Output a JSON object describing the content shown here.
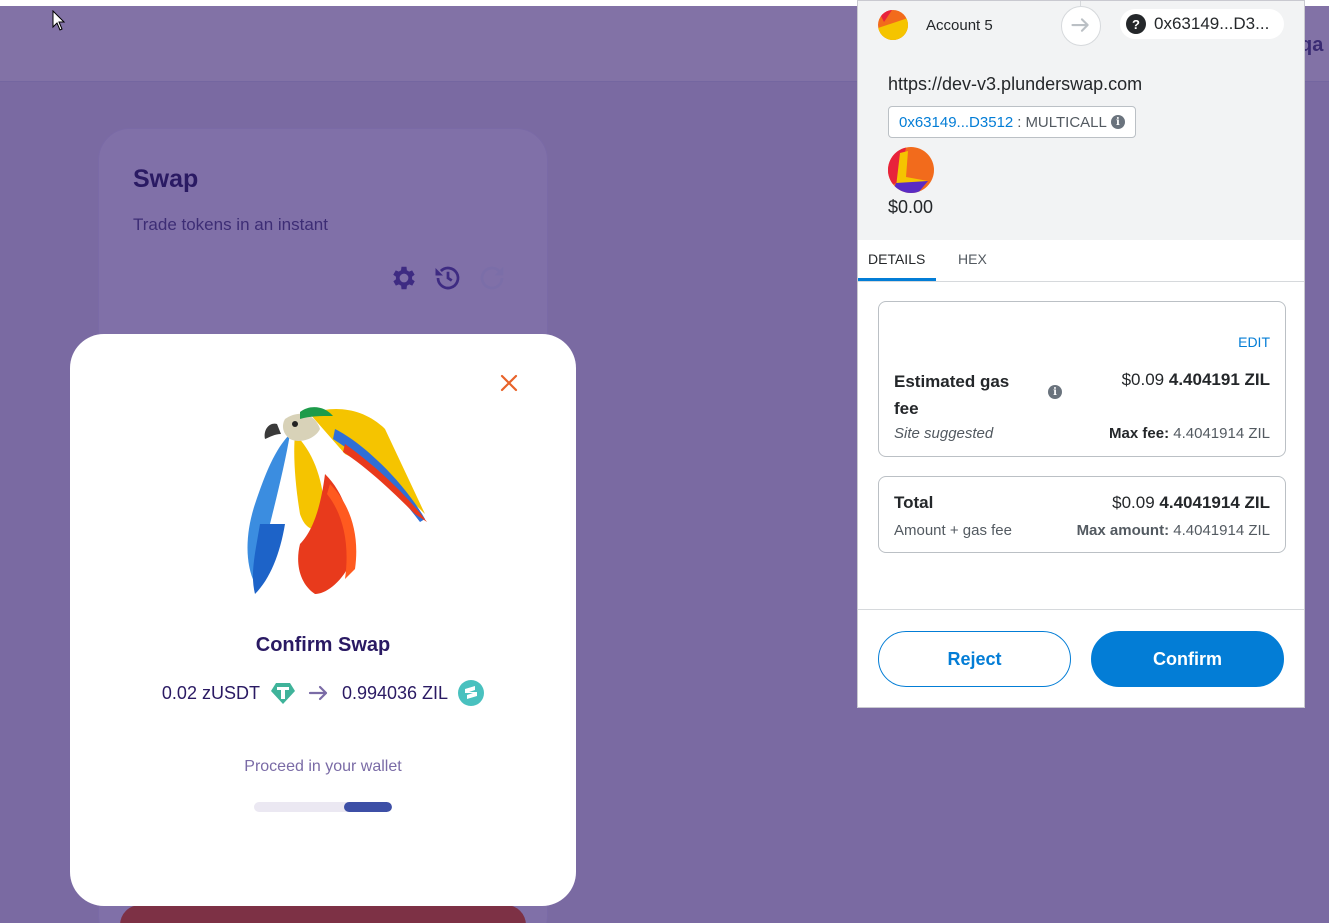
{
  "dapp": {
    "top_right_fragment": "qa",
    "swap_card": {
      "title": "Swap",
      "subtitle": "Trade tokens in an instant"
    },
    "modal": {
      "title": "Confirm Swap",
      "from_amount": "0.02 zUSDT",
      "to_amount": "0.994036 ZIL",
      "status": "Proceed in your wallet",
      "progress": 0.35
    }
  },
  "wallet": {
    "account_name": "Account 5",
    "account_address": "0x63149...D3...",
    "origin": "https://dev-v3.plunderswap.com",
    "contract_address": "0x63149...D3512",
    "contract_separator": ":",
    "contract_method": "MULTICALL",
    "value_usd": "$0.00",
    "tabs": [
      "DETAILS",
      "HEX"
    ],
    "gas": {
      "edit_label": "EDIT",
      "label": "Estimated gas fee",
      "fiat": "$0.09",
      "amount": "4.404191 ZIL",
      "site_suggested": "Site suggested",
      "max_fee_label": "Max fee:",
      "max_fee_value": "4.4041914 ZIL"
    },
    "total": {
      "label": "Total",
      "fiat": "$0.09",
      "amount": "4.4041914 ZIL",
      "sub_label": "Amount + gas fee",
      "max_amount_label": "Max amount:",
      "max_amount_value": "4.4041914 ZIL"
    },
    "buttons": {
      "reject": "Reject",
      "confirm": "Confirm"
    }
  },
  "colors": {
    "background": "#7a6aa2",
    "accent": "#037dd6",
    "progress_fill": "#3d4fa6",
    "close_icon": "#e8632a"
  }
}
